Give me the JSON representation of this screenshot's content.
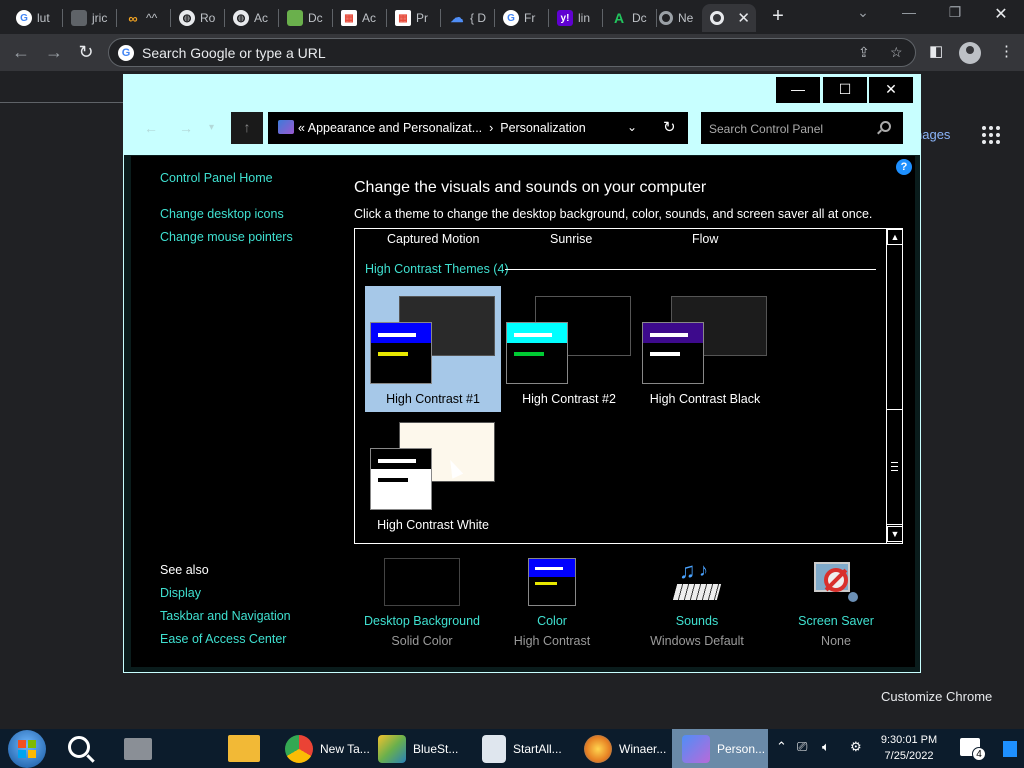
{
  "browser": {
    "tabs": [
      {
        "label": "lut",
        "favicon": "google-icon",
        "color": "#4285f4"
      },
      {
        "label": "jric",
        "favicon": "page-icon",
        "color": "#9aa0a6"
      },
      {
        "label": "^^",
        "favicon": "infinity-icon",
        "color": "#f4a522"
      },
      {
        "label": "Ro",
        "favicon": "globe-icon",
        "color": "#9aa0a6"
      },
      {
        "label": "Ac",
        "favicon": "globe-icon",
        "color": "#9aa0a6"
      },
      {
        "label": "Dc",
        "favicon": "stack-icon",
        "color": "#6ab04c"
      },
      {
        "label": "Ac",
        "favicon": "doc-icon",
        "color": "#ffffff"
      },
      {
        "label": "Pr",
        "favicon": "doc-icon",
        "color": "#ffffff"
      },
      {
        "label": "{ D",
        "favicon": "cloud-icon",
        "color": "#4f8ef7"
      },
      {
        "label": "Fr",
        "favicon": "google-icon",
        "color": "#4285f4"
      },
      {
        "label": "lin",
        "favicon": "yahoo-icon",
        "color": "#6001d2"
      },
      {
        "label": "Dc",
        "favicon": "a-icon",
        "color": "#22c55e"
      },
      {
        "label": "Ne",
        "favicon": "chrome-icon",
        "color": "#9aa0a6"
      }
    ],
    "omnibox_placeholder": "Search Google or type a URL",
    "images_link": "nages",
    "customize_label": "Customize Chrome"
  },
  "control_panel": {
    "breadcrumb": "« Appearance and Personalizat...",
    "breadcrumb_sep": "›",
    "breadcrumb_current": "Personalization",
    "search_placeholder": "Search Control Panel",
    "help": "?",
    "sidebar": {
      "home": "Control Panel Home",
      "links": [
        "Change desktop icons",
        "Change mouse pointers"
      ],
      "see_also_heading": "See also",
      "see_also": [
        "Display",
        "Taskbar and Navigation",
        "Ease of Access Center"
      ]
    },
    "title": "Change the visuals and sounds on your computer",
    "subtitle": "Click a theme to change the desktop background, color, sounds, and screen saver all at once.",
    "top_row_themes": [
      "Captured Motion",
      "Sunrise",
      "Flow"
    ],
    "group_heading": "High Contrast Themes (4)",
    "themes": [
      {
        "name": "High Contrast #1",
        "selected": true,
        "back": "#2a2a2a",
        "bar": "#0000ff",
        "line2": "#e8e800"
      },
      {
        "name": "High Contrast #2",
        "selected": false,
        "back": "#000000",
        "bar": "#00ffff",
        "line2": "#00cc33"
      },
      {
        "name": "High Contrast Black",
        "selected": false,
        "back": "#1c1c1c",
        "bar": "#3d0a8c",
        "line2": "#ffffff"
      },
      {
        "name": "High Contrast White",
        "selected": false,
        "back": "#fdf8ec",
        "bar": "#000000",
        "line2": "#000000"
      }
    ],
    "bottom": [
      {
        "label": "Desktop Background",
        "sub": "Solid Color"
      },
      {
        "label": "Color",
        "sub": "High Contrast"
      },
      {
        "label": "Sounds",
        "sub": "Windows Default"
      },
      {
        "label": "Screen Saver",
        "sub": "None"
      }
    ]
  },
  "taskbar": {
    "apps": [
      {
        "label": "New Ta...",
        "icon": "chrome-icon"
      },
      {
        "label": "BlueSt...",
        "icon": "bluestacks-icon"
      },
      {
        "label": "StartAll...",
        "icon": "startallback-icon"
      },
      {
        "label": "Winaer...",
        "icon": "winaero-icon"
      },
      {
        "label": "Person...",
        "icon": "personalization-icon"
      }
    ],
    "time": "9:30:01 PM",
    "date": "7/25/2022",
    "notification_count": "4"
  }
}
